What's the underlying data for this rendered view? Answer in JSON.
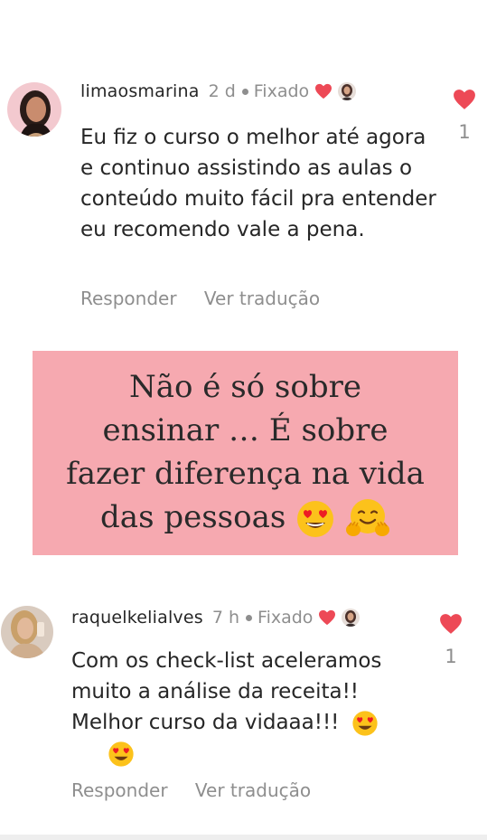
{
  "comments": [
    {
      "username": "limaosmarina",
      "time": "2 d",
      "pinned_label": "Fixado",
      "text": "Eu fiz o curso o melhor até agora e continuo assistindo as aulas o conteúdo muito fácil pra entender eu recomendo vale a pena.",
      "reply_label": "Responder",
      "translate_label": "Ver tradução",
      "like_count": "1",
      "avatar_icon": "profile-photo",
      "like_icon": "heart-filled-icon",
      "like_color": "#ed4956"
    },
    {
      "username": "raquelkelialves",
      "time": "7 h",
      "pinned_label": "Fixado",
      "text": "Com os check-list aceleramos muito a análise da receita!! Melhor curso da vidaaa!!!",
      "reply_label": "Responder",
      "translate_label": "Ver tradução",
      "like_count": "1",
      "avatar_icon": "profile-photo",
      "like_icon": "heart-filled-icon",
      "like_color": "#ed4956"
    }
  ],
  "banner": {
    "line1": "Não é só sobre",
    "line2": "ensinar … É sobre",
    "line3": "fazer diferença na vida",
    "line4": "das pessoas",
    "emojis": [
      "heart-eyes-emoji",
      "hugging-face-emoji"
    ],
    "background": "#f6a9b0"
  }
}
